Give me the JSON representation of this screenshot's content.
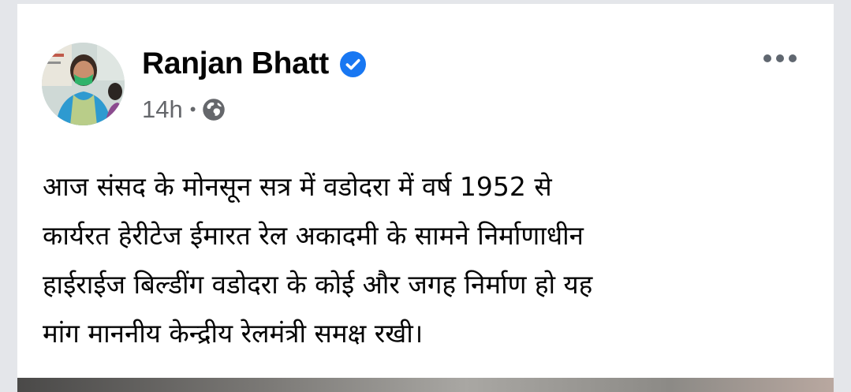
{
  "post": {
    "author": {
      "name": "Ranjan Bhatt",
      "verified": true,
      "verified_icon": "verified-badge-icon",
      "avatar": "profile-photo"
    },
    "meta": {
      "time": "14h",
      "separator": "•",
      "audience_icon": "globe-icon"
    },
    "more_icon": "more-horizontal-icon",
    "text_lines": [
      "आज संसद के मोनसून सत्र में वडोदरा में वर्ष 1952 से",
      "कार्यरत हेरीटेज ईमारत रेल अकादमी के सामने निर्माणाधीन",
      "हाईराईज बिल्डींग वडोदरा के कोई और जगह निर्माण हो यह",
      "मांग माननीय केन्द्रीय रेलमंत्री समक्ष रखी।"
    ]
  },
  "colors": {
    "verified_blue": "#1877f2",
    "secondary_text": "#65676b",
    "primary_text": "#050505",
    "page_background": "#e4e6ea"
  }
}
